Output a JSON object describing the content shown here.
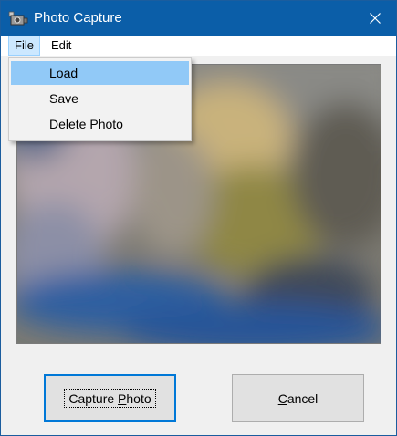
{
  "window": {
    "title": "Photo Capture",
    "icon": "camera-icon",
    "close_icon": "close-icon",
    "colors": {
      "titlebar": "#0b5ea8",
      "menu_highlight": "#91c9f7",
      "default_button_border": "#0078d7"
    }
  },
  "menubar": {
    "items": [
      {
        "label": "File",
        "open": true
      },
      {
        "label": "Edit",
        "open": false
      }
    ]
  },
  "file_menu": {
    "items": [
      {
        "label": "Load",
        "highlighted": true
      },
      {
        "label": "Save",
        "highlighted": false
      },
      {
        "label": "Delete Photo",
        "highlighted": false
      }
    ]
  },
  "buttons": {
    "capture": {
      "before": "Capture ",
      "mnemonic": "P",
      "after": "hoto",
      "default": true
    },
    "cancel": {
      "before": "",
      "mnemonic": "C",
      "after": "ancel",
      "default": false
    }
  }
}
